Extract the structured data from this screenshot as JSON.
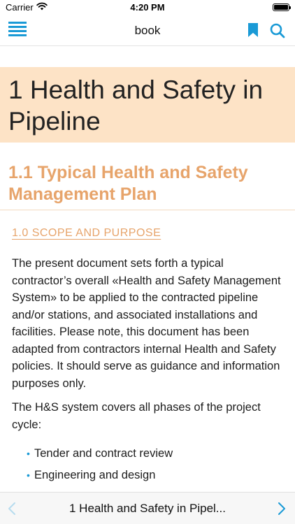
{
  "status_bar": {
    "carrier": "Carrier",
    "time": "4:20 PM",
    "icons": [
      "wifi-icon",
      "battery-icon"
    ]
  },
  "nav": {
    "title": "book",
    "icons": [
      "menu-icon",
      "bookmark-icon",
      "search-icon"
    ],
    "accent_color": "#1a9ad6"
  },
  "chapter": {
    "title": "1 Health and Safety in Pipeline",
    "header_bg": "#fde3c6"
  },
  "section": {
    "title": "1.1 Typical Health and Safety Management Plan",
    "color": "#e7a46b"
  },
  "subsection": {
    "title": "1.0 SCOPE AND PURPOSE"
  },
  "paragraphs": [
    "The present document sets forth a typical contractor’s overall «Health and Safety Management System» to be applied to the contracted pipeline and/or stations, and associated installations and facilities. Please note, this document has been adapted from contractors internal Health and Safety policies. It should serve as guidance and information purposes only.",
    "The H&S system covers all phases of the project cycle:"
  ],
  "bullets": [
    "Tender and contract review",
    "Engineering and design"
  ],
  "bottom_bar": {
    "title": "1 Health and Safety in Pipel...",
    "icons": [
      "chevron-left-icon",
      "chevron-right-icon"
    ]
  }
}
